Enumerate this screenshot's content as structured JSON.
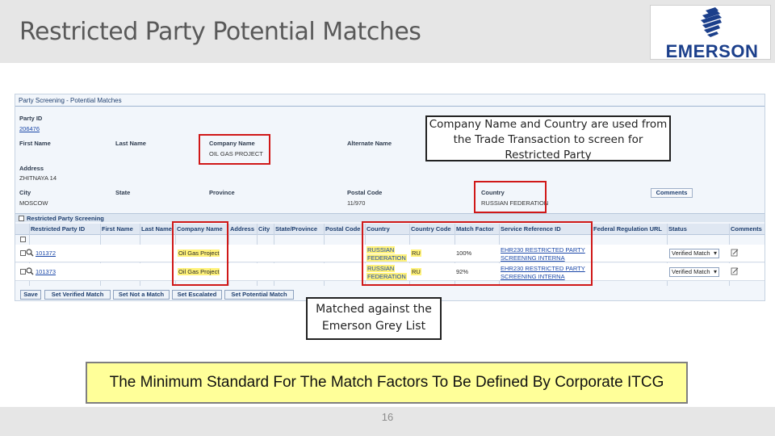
{
  "slide": {
    "title": "Restricted Party Potential Matches",
    "page_number": "16",
    "logo_text": "EMERSON"
  },
  "app": {
    "title": "Party Screening - Potential Matches",
    "party_id_label": "Party ID",
    "party_id_value": "206476",
    "first_name_label": "First Name",
    "last_name_label": "Last Name",
    "company_name_label": "Company Name",
    "company_name_value": "OIL GAS PROJECT",
    "alternate_name_label": "Alternate Name",
    "address_label": "Address",
    "address_value": "ZHITNAYA 14",
    "city_label": "City",
    "city_value": "MOSCOW",
    "state_label": "State",
    "province_label": "Province",
    "postal_code_label": "Postal Code",
    "postal_code_value": "11/970",
    "country_label": "Country",
    "country_value": "RUSSIAN FEDERATION",
    "comments_button": "Comments",
    "section_title": "Restricted Party Screening",
    "columns": [
      "Restricted Party ID",
      "First Name",
      "Last Name",
      "Company Name",
      "Address",
      "City",
      "State/Province",
      "Postal Code",
      "Country",
      "Country Code",
      "Match Factor",
      "Service Reference ID",
      "Federal Regulation URL",
      "Status",
      "Comments"
    ],
    "rows": [
      {
        "party_id": "101372",
        "company": "Oil Gas Project",
        "country_line1": "RUSSIAN",
        "country_line2": "FEDERATION",
        "country_code": "RU",
        "match_factor": "100%",
        "ref_line1": "EHR230 RESTRICTED PARTY",
        "ref_line2": "SCREENING INTERNA",
        "status": "Verified Match"
      },
      {
        "party_id": "101373",
        "company": "Oil Gas Project",
        "country_line1": "RUSSIAN",
        "country_line2": "FEDERATION",
        "country_code": "RU",
        "match_factor": "92%",
        "ref_line1": "EHR230 RESTRICTED PARTY",
        "ref_line2": "SCREENING INTERNA",
        "status": "Verified Match"
      }
    ],
    "buttons": {
      "save": "Save",
      "set_verified": "Set Verified Match",
      "set_not": "Set Not a Match",
      "set_escalated": "Set Escalated",
      "set_potential": "Set Potential Match"
    }
  },
  "callouts": {
    "company_country": "Company Name and Country are used from the Trade Transaction to screen for Restricted Party",
    "grey_list": "Matched against the Emerson Grey List",
    "banner": "The Minimum Standard For The Match Factors To Be Defined By Corporate ITCG"
  },
  "colors": {
    "highlight_box": "#d01818",
    "banner_fill": "#ffff99",
    "cell_highlight": "#fff27a",
    "brand_blue": "#1b3f8b"
  },
  "icons": {
    "row_view": "magnifier-icon",
    "row_comment": "edit-note-icon",
    "logo_mark": "emerson-stripes-icon"
  }
}
